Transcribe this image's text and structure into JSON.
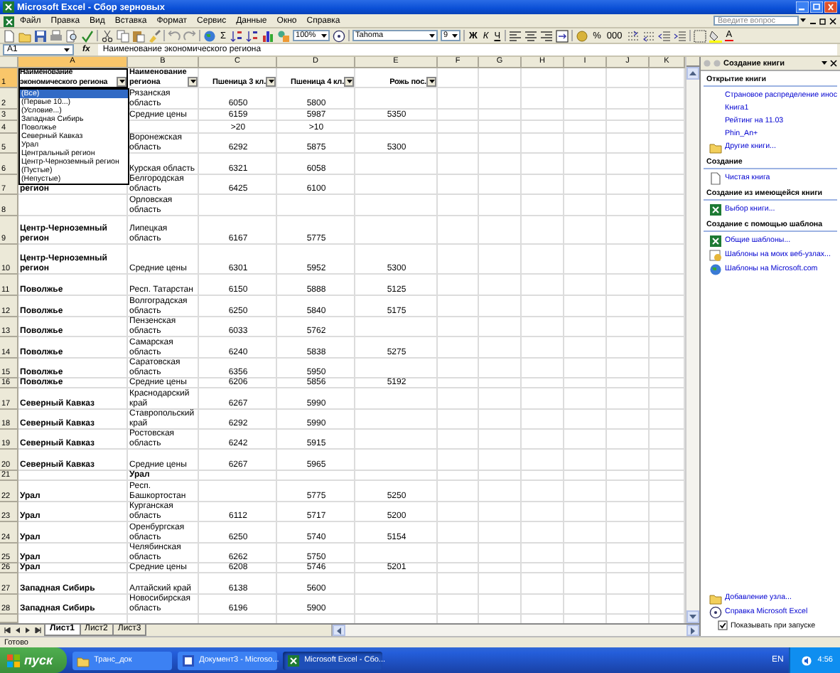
{
  "window": {
    "title": "Microsoft Excel - Сбор зерновых"
  },
  "menu": {
    "items": [
      "Файл",
      "Правка",
      "Вид",
      "Вставка",
      "Формат",
      "Сервис",
      "Данные",
      "Окно",
      "Справка"
    ],
    "help_search": {
      "placeholder": "Введите вопрос"
    }
  },
  "toolbar": {
    "sum": "Σ",
    "zoom": "100%",
    "font": "Tahoma",
    "font_size": "9",
    "bold": "Ж",
    "italic": "К",
    "underline": "Ч",
    "percent": "%",
    "thousands": "000",
    "font_color": "А"
  },
  "formula_bar": {
    "name_box": "A1",
    "fx": "fx",
    "formula": "Наименование экономического региона"
  },
  "sheet": {
    "columns": [
      {
        "label": "A",
        "selected": true
      },
      {
        "label": "B",
        "selected": false
      },
      {
        "label": "C",
        "selected": false
      },
      {
        "label": "D",
        "selected": false
      },
      {
        "label": "E",
        "selected": false
      },
      {
        "label": "F",
        "selected": false
      },
      {
        "label": "G",
        "selected": false
      },
      {
        "label": "H",
        "selected": false
      },
      {
        "label": "I",
        "selected": false
      },
      {
        "label": "J",
        "selected": false
      },
      {
        "label": "K",
        "selected": false
      }
    ],
    "rows": [
      {
        "number": "1",
        "selected": true,
        "kind": "header",
        "a": "Наименование экономического региона",
        "b": "Наименование региона",
        "c": "Пшеница 3 кл.",
        "d": "Пшеница 4 кл.",
        "e": "Рожь пос."
      },
      {
        "number": "2",
        "selected": false,
        "kind": "data",
        "b": "Рязанская область",
        "c": "6050",
        "d": "5800"
      },
      {
        "number": "3",
        "selected": false,
        "kind": "data",
        "b": "Средние цены",
        "c": "6159",
        "d": "5987",
        "e": "5350"
      },
      {
        "number": "4",
        "selected": false,
        "kind": "data",
        "c": ">20",
        "d": ">10"
      },
      {
        "number": "5",
        "selected": false,
        "kind": "data",
        "b": "Воронежская область",
        "c": "6292",
        "d": "5875",
        "e": "5300"
      },
      {
        "number": "6",
        "selected": false,
        "kind": "data",
        "b": "Курская область",
        "c": "6321",
        "d": "6058"
      },
      {
        "number": "7",
        "selected": false,
        "kind": "data",
        "a": "регион",
        "b": "Белгородская область",
        "c": "6425",
        "d": "6100"
      },
      {
        "number": "8",
        "selected": false,
        "kind": "data",
        "b": "Орловская область"
      },
      {
        "number": "9",
        "selected": false,
        "kind": "data",
        "a": "Центр-Черноземный регион",
        "b": "Липецкая область",
        "c": "6167",
        "d": "5775"
      },
      {
        "number": "10",
        "selected": false,
        "kind": "data",
        "a": "Центр-Черноземный регион",
        "b": "Средние цены",
        "c": "6301",
        "d": "5952",
        "e": "5300"
      },
      {
        "number": "11",
        "selected": false,
        "kind": "data",
        "a": "Поволжье",
        "b": "Респ. Татарстан",
        "c": "6150",
        "d": "5888",
        "e": "5125"
      },
      {
        "number": "12",
        "selected": false,
        "kind": "data",
        "a": "Поволжье",
        "b": "Волгоградская область",
        "c": "6250",
        "d": "5840",
        "e": "5175"
      },
      {
        "number": "13",
        "selected": false,
        "kind": "data",
        "a": "Поволжье",
        "b": "Пензенская область",
        "c": "6033",
        "d": "5762"
      },
      {
        "number": "14",
        "selected": false,
        "kind": "data",
        "a": "Поволжье",
        "b": "Самарская область",
        "c": "6240",
        "d": "5838",
        "e": "5275"
      },
      {
        "number": "15",
        "selected": false,
        "kind": "data",
        "a": "Поволжье",
        "b": "Саратовская область",
        "c": "6356",
        "d": "5950"
      },
      {
        "number": "16",
        "selected": false,
        "kind": "data",
        "a": "Поволжье",
        "b": "Средние цены",
        "c": "6206",
        "d": "5856",
        "e": "5192"
      },
      {
        "number": "17",
        "selected": false,
        "kind": "data",
        "a": "Северный Кавказ",
        "b": "Краснодарский край",
        "c": "6267",
        "d": "5990"
      },
      {
        "number": "18",
        "selected": false,
        "kind": "data",
        "a": "Северный Кавказ",
        "b": "Ставропольский край",
        "c": "6292",
        "d": "5990"
      },
      {
        "number": "19",
        "selected": false,
        "kind": "data",
        "a": "Северный Кавказ",
        "b": "Ростовская область",
        "c": "6242",
        "d": "5915"
      },
      {
        "number": "20",
        "selected": false,
        "kind": "data",
        "a": "Северный Кавказ",
        "b": "Средние цены",
        "c": "6267",
        "d": "5965"
      },
      {
        "number": "21",
        "selected": false,
        "kind": "group",
        "b": "Урал"
      },
      {
        "number": "22",
        "selected": false,
        "kind": "data",
        "a": "Урал",
        "b": "Респ. Башкортостан",
        "d": "5775",
        "e": "5250"
      },
      {
        "number": "23",
        "selected": false,
        "kind": "data",
        "a": "Урал",
        "b": "Курганская область",
        "c": "6112",
        "d": "5717",
        "e": "5200"
      },
      {
        "number": "24",
        "selected": false,
        "kind": "data",
        "a": "Урал",
        "b": "Оренбургская область",
        "c": "6250",
        "d": "5740",
        "e": "5154"
      },
      {
        "number": "25",
        "selected": false,
        "kind": "data",
        "a": "Урал",
        "b": "Челябинская область",
        "c": "6262",
        "d": "5750"
      },
      {
        "number": "26",
        "selected": false,
        "kind": "data",
        "a": "Урал",
        "b": "Средние цены",
        "c": "6208",
        "d": "5746",
        "e": "5201"
      },
      {
        "number": "27",
        "selected": false,
        "kind": "data",
        "a": "Западная Сибирь",
        "b": "Алтайский край",
        "c": "6138",
        "d": "5600"
      },
      {
        "number": "28",
        "selected": false,
        "kind": "data",
        "a": "Западная Сибирь",
        "b": "Новосибирская область",
        "c": "6196",
        "d": "5900"
      }
    ]
  },
  "filter_menu": {
    "items": [
      {
        "label": "(Все)",
        "selected": true
      },
      {
        "label": "(Первые 10...)",
        "selected": false
      },
      {
        "label": "(Условие...)",
        "selected": false
      },
      {
        "label": "Западная Сибирь",
        "selected": false
      },
      {
        "label": "Поволжье",
        "selected": false
      },
      {
        "label": "Северный Кавказ",
        "selected": false
      },
      {
        "label": "Урал",
        "selected": false
      },
      {
        "label": "Центральный регион",
        "selected": false
      },
      {
        "label": "Центр-Черноземный регион",
        "selected": false
      },
      {
        "label": "(Пустые)",
        "selected": false
      },
      {
        "label": "(Непустые)",
        "selected": false
      }
    ]
  },
  "task_pane": {
    "title": "Создание книги",
    "sections": [
      {
        "heading": "Открытие книги",
        "links": [
          {
            "label": "Страновое распределение инос",
            "kind": "plain"
          },
          {
            "label": "Книга1",
            "kind": "plain"
          },
          {
            "label": "Рейтинг на 11.03",
            "kind": "plain"
          },
          {
            "label": "Phin_An+",
            "kind": "plain"
          },
          {
            "label": "Другие книги...",
            "kind": "folder"
          }
        ]
      },
      {
        "heading": "Создание",
        "links": [
          {
            "label": "Чистая книга",
            "kind": "page"
          }
        ]
      },
      {
        "heading": "Создание из имеющейся книги",
        "links": [
          {
            "label": "Выбор книги...",
            "kind": "workbook"
          }
        ]
      },
      {
        "heading": "Создание с помощью шаблона",
        "links": [
          {
            "label": "Общие шаблоны...",
            "kind": "workbook"
          },
          {
            "label": "Шаблоны на моих веб-узлах...",
            "kind": "web"
          },
          {
            "label": "Шаблоны на Microsoft.com",
            "kind": "globe"
          }
        ]
      }
    ],
    "footer_links": [
      {
        "label": "Добавление узла...",
        "kind": "folder"
      },
      {
        "label": "Справка Microsoft Excel",
        "kind": "help"
      }
    ],
    "startup_checkbox": {
      "label": "Показывать при запуске",
      "checked": true
    }
  },
  "sheet_tabs": [
    {
      "label": "Лист1",
      "selected": true
    },
    {
      "label": "Лист2",
      "selected": false
    },
    {
      "label": "Лист3",
      "selected": false
    }
  ],
  "status_bar": {
    "text": "Готово"
  },
  "taskbar": {
    "start": "пуск",
    "tasks": [
      {
        "label": "Транс_док",
        "kind": "folder",
        "selected": false
      },
      {
        "label": "Документ3 - Microso...",
        "kind": "word",
        "selected": false
      },
      {
        "label": "Microsoft Excel - Сбо...",
        "kind": "excel",
        "selected": true
      }
    ],
    "language": "EN",
    "clock": "4:56"
  }
}
